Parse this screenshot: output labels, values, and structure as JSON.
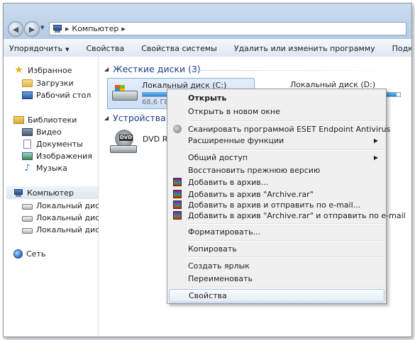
{
  "address": {
    "crumbs": [
      "Компьютер"
    ]
  },
  "toolbar": {
    "organize": "Упорядочить",
    "properties": "Свойства",
    "system_properties": "Свойства системы",
    "uninstall": "Удалить или изменить программу",
    "map_drive": "Подключить сетевой ди"
  },
  "sidebar": {
    "favorites": "Избранное",
    "downloads": "Загрузки",
    "desktop": "Рабочий стол",
    "libraries": "Библиотеки",
    "video": "Видео",
    "documents": "Документы",
    "images": "Изображения",
    "music": "Музыка",
    "computer": "Компьютер",
    "disk_c": "Локальный диск (C",
    "disk_d": "Локальный диск (D",
    "disk_e": "Локальный диск (E:",
    "network": "Сеть"
  },
  "main": {
    "hdd_group": "Жесткие диски (3)",
    "removable_group": "Устройства со",
    "drive_c": {
      "name": "Локальный диск (C:)",
      "free": "68,6 ГБ",
      "usage_fraction": 0.45
    },
    "drive_d": {
      "name": "Локальный диск (D:)",
      "usage_fraction": 0.97
    },
    "dvd": {
      "name": "DVD RW",
      "badge": "DVD"
    }
  },
  "context_menu": {
    "open": "Открыть",
    "open_new_window": "Открыть в новом окне",
    "eset_scan": "Сканировать программой ESET Endpoint Antivirus",
    "advanced": "Расширенные функции",
    "share": "Общий доступ",
    "restore_previous": "Восстановить прежнюю версию",
    "add_archive": "Добавить в архив...",
    "add_archive_rar": "Добавить в архив \"Archive.rar\"",
    "add_archive_email": "Добавить в архив и отправить по e-mail...",
    "add_archive_rar_email": "Добавить в архив \"Archive.rar\" и отправить по e-mail",
    "format": "Форматировать...",
    "copy": "Копировать",
    "create_shortcut": "Создать ярлык",
    "rename": "Переименовать",
    "properties": "Свойства"
  }
}
